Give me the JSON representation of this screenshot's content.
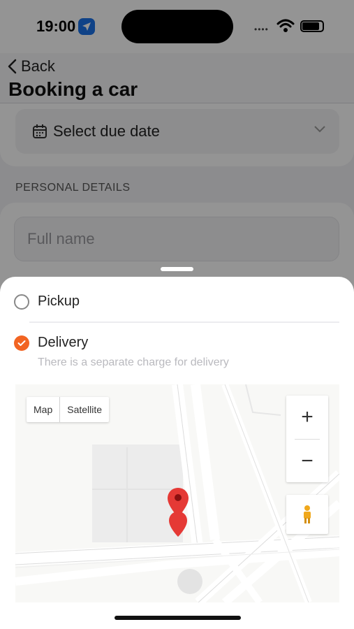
{
  "status": {
    "time": "19:00"
  },
  "nav": {
    "back_label": "Back",
    "title": "Booking a car"
  },
  "form": {
    "due_date_placeholder": "Select due date",
    "section_personal": "PERSONAL DETAILS",
    "full_name_placeholder": "Full name"
  },
  "sheet": {
    "options": [
      {
        "label": "Pickup",
        "selected": false
      },
      {
        "label": "Delivery",
        "selected": true
      }
    ],
    "delivery_note": "There is a separate charge for delivery"
  },
  "map": {
    "type_tabs": [
      "Map",
      "Satellite"
    ],
    "zoom_in": "+",
    "zoom_out": "−"
  },
  "colors": {
    "accent": "#f26422",
    "pin": "#e53935",
    "location_badge": "#1a73e8"
  }
}
